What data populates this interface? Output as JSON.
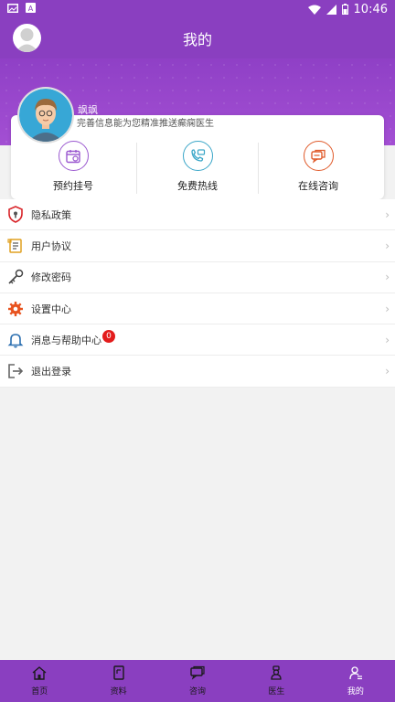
{
  "status_bar": {
    "time": "10:46"
  },
  "header": {
    "title": "我的"
  },
  "profile": {
    "name": "飒飒",
    "subtitle": "完善信息能为您精准推送癫痫医生"
  },
  "quick_actions": [
    {
      "label": "预约挂号",
      "icon": "calendar-icon",
      "color": "#9b59d0"
    },
    {
      "label": "免费热线",
      "icon": "phone-chat-icon",
      "color": "#3aa6c8"
    },
    {
      "label": "在线咨询",
      "icon": "chat-bubbles-icon",
      "color": "#e05a2a"
    }
  ],
  "menu": [
    {
      "label": "隐私政策",
      "icon": "shield-icon"
    },
    {
      "label": "用户协议",
      "icon": "scroll-icon"
    },
    {
      "label": "修改密码",
      "icon": "key-icon"
    },
    {
      "label": "设置中心",
      "icon": "gear-icon"
    },
    {
      "label": "消息与帮助中心",
      "icon": "bell-icon",
      "badge": "0"
    },
    {
      "label": "退出登录",
      "icon": "logout-icon"
    }
  ],
  "tabs": [
    {
      "label": "首页",
      "icon": "home-icon"
    },
    {
      "label": "资料",
      "icon": "document-icon"
    },
    {
      "label": "咨询",
      "icon": "chat-icon"
    },
    {
      "label": "医生",
      "icon": "doctor-icon"
    },
    {
      "label": "我的",
      "icon": "profile-icon",
      "active": true
    }
  ],
  "colors": {
    "brand": "#8a3fc0",
    "badge": "#e31c1c"
  }
}
